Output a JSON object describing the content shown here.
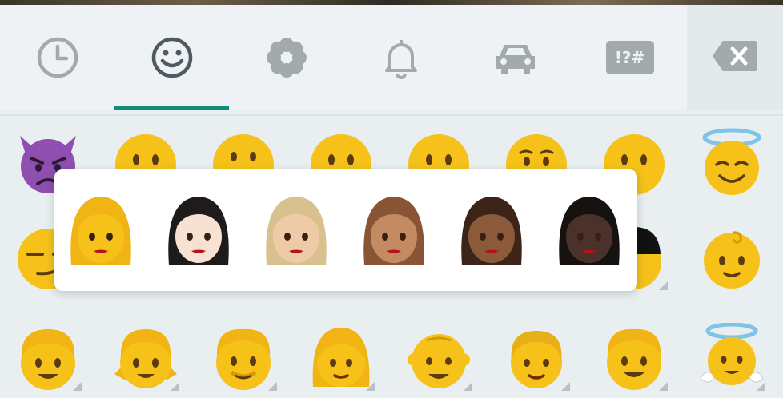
{
  "tabs": [
    {
      "icon": "clock-icon",
      "active": false
    },
    {
      "icon": "smiley-icon",
      "active": true
    },
    {
      "icon": "flower-icon",
      "active": false
    },
    {
      "icon": "bell-icon",
      "active": false
    },
    {
      "icon": "car-icon",
      "active": false
    },
    {
      "icon": "symbols-icon",
      "label": "!?#",
      "active": false
    }
  ],
  "backspace": {
    "icon": "backspace-icon"
  },
  "colors": {
    "accent": "#138b7c",
    "icon_gray": "#a2aaae",
    "icon_active": "#4f5a60",
    "emoji_yellow": "#f6c21a",
    "popup_bg": "#ffffff"
  },
  "emoji_grid": {
    "row1": [
      "smiling-imp",
      "face-without-mouth",
      "grimacing-face",
      "face-without-mouth",
      "face-without-mouth",
      "flushed-face",
      "face-without-mouth",
      "smiling-face-with-halo"
    ],
    "row2": [
      "smirking-face",
      "man-with-turban",
      "baby"
    ],
    "row3": [
      "boy",
      "girl",
      "man",
      "woman",
      "older-man",
      "older-woman",
      "man",
      "baby-angel"
    ]
  },
  "skin_tone_popup": {
    "emoji": "woman",
    "tones": [
      {
        "name": "default",
        "hair": "#f0b415",
        "skin": "#f6c21a"
      },
      {
        "name": "light",
        "hair": "#1e1b1a",
        "skin": "#f7e1d2"
      },
      {
        "name": "medium-light",
        "hair": "#d8c08f",
        "skin": "#eecba6"
      },
      {
        "name": "medium",
        "hair": "#8a5534",
        "skin": "#c48a62"
      },
      {
        "name": "medium-dark",
        "hair": "#3d2418",
        "skin": "#8b5a3b"
      },
      {
        "name": "dark",
        "hair": "#161210",
        "skin": "#4a322a"
      }
    ]
  }
}
